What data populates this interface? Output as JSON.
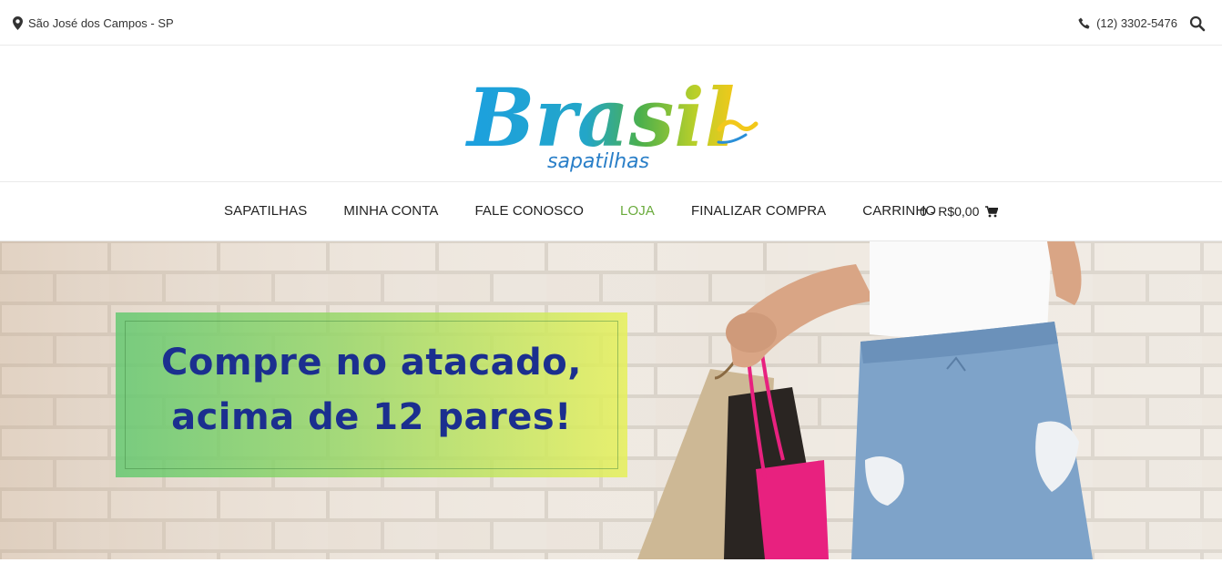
{
  "topbar": {
    "location": "São José dos Campos - SP",
    "location_icon": "map-pin-icon",
    "phone": "(12) 3302-5476",
    "phone_icon": "phone-icon",
    "search_icon": "search-icon"
  },
  "logo": {
    "main": "Brasil",
    "sub": "sapatilhas"
  },
  "nav": {
    "items": [
      {
        "label": "SAPATILHAS"
      },
      {
        "label": "MINHA CONTA"
      },
      {
        "label": "FALE CONOSCO"
      },
      {
        "label": "LOJA"
      },
      {
        "label": "FINALIZAR COMPRA"
      },
      {
        "label": "CARRINHO"
      }
    ],
    "active_index": 3,
    "active_color": "#6aab3c",
    "cart_label": "0 - R$0,00",
    "cart_icon": "shopping-cart-icon"
  },
  "hero": {
    "line1": "Compre no atacado,",
    "line2": "acima de 12 pares!",
    "text_color": "#1b2f8f"
  }
}
